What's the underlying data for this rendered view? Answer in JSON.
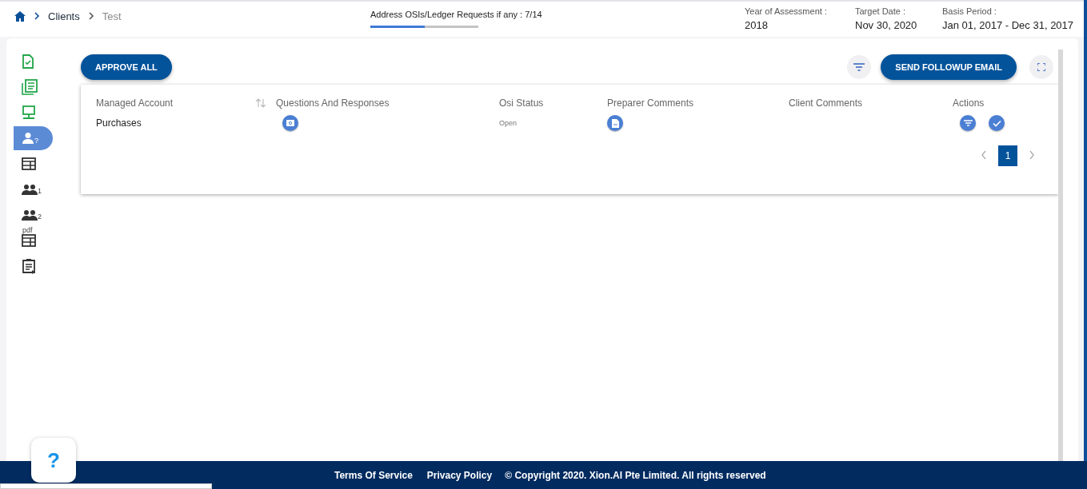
{
  "breadcrumb": [
    {
      "label": "Clients",
      "current": false
    },
    {
      "label": "Test",
      "current": true
    }
  ],
  "progress": {
    "label": "Address OSIs/Ledger Requests if any : 7/14",
    "level": 0.5
  },
  "info": [
    {
      "label": "Year of Assessment :",
      "value": "2018"
    },
    {
      "label": "Target Date :",
      "value": "Nov 30, 2020"
    },
    {
      "label": "Basis Period :",
      "value": "Jan 01, 2017 - Dec 31, 2017"
    }
  ],
  "sidebar": {
    "items": [
      {
        "kind": "doc-check",
        "selected": false
      },
      {
        "kind": "list",
        "selected": false
      },
      {
        "kind": "monitor",
        "selected": false
      },
      {
        "kind": "person",
        "badge": "?",
        "selected": true
      },
      {
        "kind": "table",
        "selected": false
      },
      {
        "kind": "people",
        "badge": "1",
        "selected": false
      },
      {
        "kind": "people",
        "badge": "2",
        "selected": false
      },
      {
        "kind": "pdf-table",
        "badge": "pdf",
        "selected": false
      },
      {
        "kind": "clipboard",
        "selected": false
      }
    ]
  },
  "toolbar": {
    "approve_button": "APPROVE ALL",
    "followup_button": "SEND FOLLOWUP EMAIL"
  },
  "table": {
    "columns": [
      "Managed Account",
      "Questions And Responses",
      "Osi Status",
      "Preparer Comments",
      "Client Comments",
      "Actions"
    ],
    "rows": [
      {
        "account": "Purchases",
        "status": "Open"
      }
    ]
  },
  "pagination": {
    "pages": [
      {
        "label": "1",
        "selected": true
      }
    ]
  },
  "help_button": "?",
  "footer": {
    "links": [
      "Terms Of Service",
      "Privacy Policy"
    ],
    "copyright": "© Copyright 2020. Xion.AI Pte Limited. All rights reserved"
  }
}
